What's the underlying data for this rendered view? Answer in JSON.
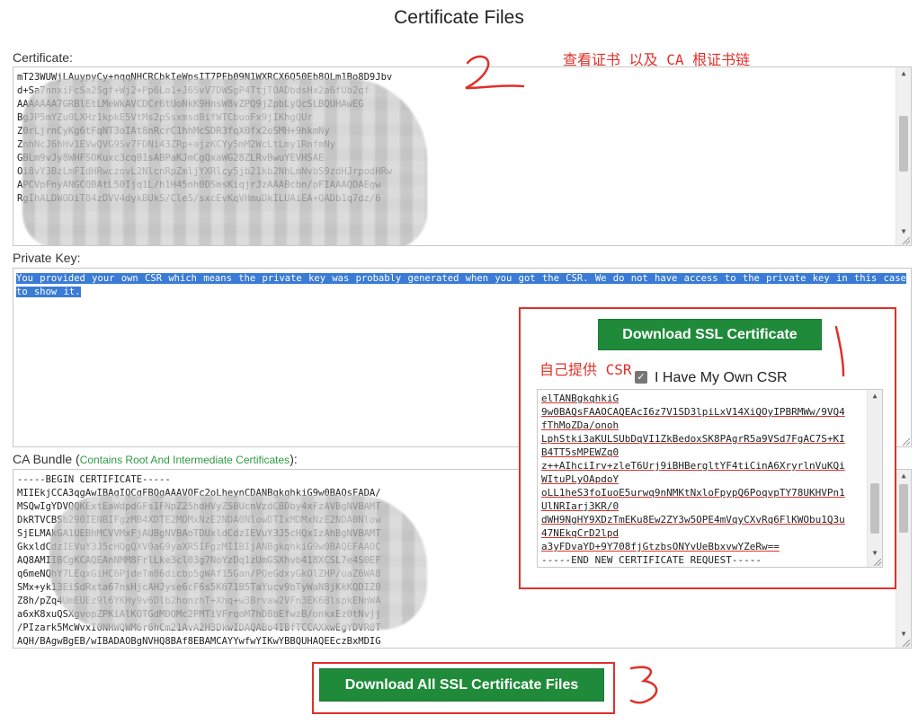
{
  "page_title": "Certificate Files",
  "certificate": {
    "label": "Certificate:",
    "lines": [
      "mT23WUWjLAuypyCy+nqqNHCRCbkIeWpsIT7PFb09N1WXRCX6Q50Eb8OLm1Bo8D9Jbv",
      "d+Sa7nnxiFcSa2Sgf+Wj2+Pp6Lo1+J6SvV7DWSgP4TtjTOADbdsHx2a6fUb2qf",
      "AAAAAAA7GRBlEtLMeWkAVCDCr6tUoNkK9HnsW8vZPQ9jZpbLyQcSLBQUHAwEG",
      "BgJP5mYZu0LXHz1kpkE5VtMs2pSsxmsd8ifWTCbuoFx9jIKhgQUr",
      "Z0rLjrnCyKg6tFqNT3oIAt8nRcrC1hhMcSDR3fqX0fx2oSMH+9hkmNy",
      "ZnhNcJ6hHv1EVwQVG9Sv7FDNi43ZRp+ajzKCYy5mM2WcLtLmy1RnfmNy",
      "GBLm9vJy8WHFSOKuxc3cqB1sABPaKJmCgQxaWG28ZLRvBwuYEVHSAE",
      "Oi8vY3BzLmFIdHRwczovL2NlcnRpZmljYXRlcy5jb21kb2NhLmNvbS9zdHJrpodHRw",
      "APCVpFnyANGCQBAtL50Ijq1L/h1H45nh0DSmsKiqjrJzAAABcbn/pFIAAAQDAEgw",
      "RgIhALDWODiT84zDVV4dykBUkS/Cle5/sxcEvKqVHmuDkILUAiEA+QADb1q7dz/6"
    ]
  },
  "private_key": {
    "label": "Private Key:",
    "text": "You provided your own CSR which means the private key was probably generated when you got the CSR. We do not have access to the private key in this case to show it."
  },
  "ca_bundle": {
    "label_main": "CA Bundle (",
    "label_hint": "Contains Root And Intermediate Certificates",
    "label_end": "):",
    "lines": [
      "-----BEGIN CERTIFICATE-----",
      "MIIEkjCCA3qgAwIBAgIQCgFBQgAAAVOFc2oLheynCDANBgkqhkiG9w0BAQsFADA/",
      "MSQwIgYDVQQKExtEaWdpdGFsIFNpZ25hdHVyZSBUcnVzdCBDby4xFzAVBgNVBAMT",
      "DkRTVCBSb290IENBIFgzMB4XDTE2MDMxNzE2NDA0NlowDTIxMDMxNzE2NDA0Nlow",
      "SjELMAkGA1UEBhMCVVMxFjAUBgNVBAoTDUxldCdzIEVuY3J5cHQxIzAhBgNVBAMT",
      "GkxldCdzIEVuY3J5cHQgQXV0aG9yaXR5IFgzMIIBIjANBgkqhkiG9w0BAQEFAAOC",
      "AQ8AMIIBCgKCAQEAnNMM8FrlLke3cl03g7NoYzDq1zUmGSXhvb418XCSL7e4S0EF",
      "q6meNQhY7LEqxGiHC6PjdeTm86dicbp5gWAf15Gan/PQeGdxyGkOlZHP/uaZ6WA8",
      "SMx+yk13EiSdRxta67nsHjcAHJyse6cF6s5K671B5TaYucv9bTyWaN8jKkKQDIZ0",
      "Z8h/pZq4UmEUEz9l6YKHy9v6Dlb2honzhT+Xhq+w3Brvaw2VFn3EK6BlspkENnWA",
      "a6xK8xuQSXgvopZPKiAlKQTGdMDQMc2PMTiVFrqoM7hD8bEfwzB/onkxEz0tNvjj",
      "/PIzark5McWvxI0NHWQWM6r6hCm21AvA2H3DkwIDAQABo4IBfTCCAXkwEgYDVR0T",
      "AQH/BAgwBgEB/wIBADAOBgNVHQ8BAf8EBAMCAYYwfwYIKwYBBQUHAQEEczBxMDIG"
    ]
  },
  "csr_panel": {
    "download_ssl_button": "Download SSL Certificate",
    "own_csr_checkbox_label": "I Have My Own CSR",
    "own_csr_checked": true,
    "csr_lines": [
      "elTANBgkqhkiG",
      "9w0BAQsFAAOCAQEAcI6z7V1SD3lpiLxV14XiQOyIPBRMWw/9VQ4",
      "fThMoZDa/onoh",
      "LphStki3aKULSUbDqVI1ZkBedoxSK8PAgrR5a9VSd7FgAC7S+KI",
      "B4TT5sMPEWZq0",
      "z++AIhciIrv+zleT6Urj9iBHBergltYF4tiCinA6XryrlnVuKQi",
      "WItuPLyOApdoY",
      "oLL1heS3foIuoE5urwq9nNMKtNxloFpypQ6PoqvpTY78UKHVPn1",
      "UlNRIarj3KR/0",
      "dWH9NgHY9XDzTmEKu8Ew2ZY3w5OPE4mVqyCXvRq6FlKWObu1Q3u",
      "47NEkqCrD2lpd",
      "a3yFDvaYD+9Y708fjGtzbsONYvUeBbxvwYZeRw==",
      "-----END NEW CERTIFICATE REQUEST-----"
    ]
  },
  "download_all_button": "Download All SSL Certificate Files",
  "annotations": {
    "view_cert_chain": "查看证书 以及 CA 根证书链",
    "own_csr": "自己提供 CSR",
    "mark_1": "1",
    "mark_2": "2",
    "mark_3": "3"
  },
  "colors": {
    "accent_green": "#1f8b3a",
    "annotation_red": "#e0302a",
    "selection_blue": "#3a7bd5"
  }
}
